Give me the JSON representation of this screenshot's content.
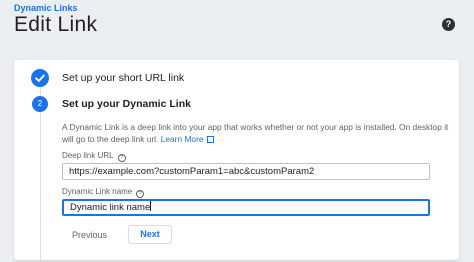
{
  "header": {
    "breadcrumb": "Dynamic Links",
    "title": "Edit Link",
    "help_icon": "help-icon",
    "help_glyph": "?"
  },
  "steps": [
    {
      "number": "",
      "title": "Set up your short URL link",
      "status": "complete",
      "icon": "check-icon"
    },
    {
      "number": "2",
      "title": "Set up your Dynamic Link",
      "status": "active"
    }
  ],
  "step2": {
    "description": "A Dynamic Link is a deep link into your app that works whether or not your app is installed. On desktop it will go to the deep link url.",
    "learn_more": "Learn More",
    "deep_link_label": "Deep link URL",
    "deep_link_value": "https://example.com?customParam1=abc&customParam2",
    "link_name_label": "Dynamic Link name",
    "link_name_value": "Dynamic link name",
    "info_glyph": "?",
    "previous_label": "Previous",
    "next_label": "Next"
  },
  "colors": {
    "accent": "#1a73e8",
    "background": "#eceff1"
  }
}
